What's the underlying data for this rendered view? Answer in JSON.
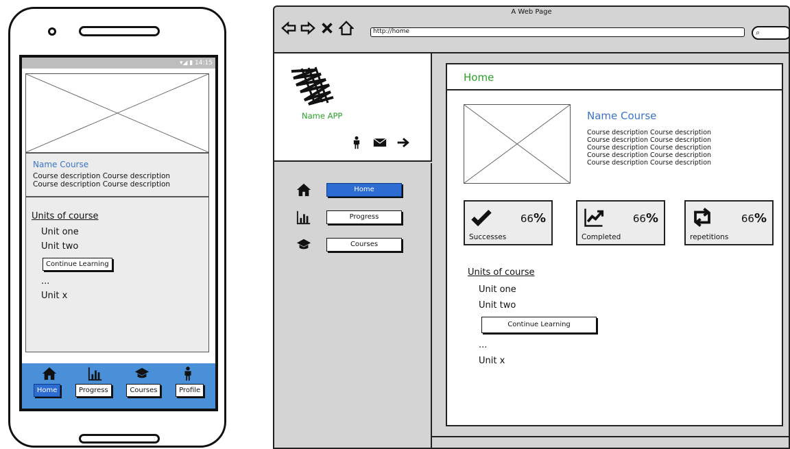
{
  "phone": {
    "status": "▾◢ ▮ 14:15",
    "course": {
      "title": "Name Course",
      "desc_line_1": "Course description  Course description",
      "desc_line_2": "Course description  Course description"
    },
    "units": {
      "title": "Units of course",
      "unit_one": "Unit one",
      "unit_two": "Unit two",
      "continue": "Continue Learning",
      "ellipsis": "...",
      "unit_x": "Unit x"
    },
    "nav": {
      "home": "Home",
      "progress": "Progress",
      "courses": "Courses",
      "profile": "Profile"
    }
  },
  "browser": {
    "title": "A Web Page",
    "url": "http://home",
    "app_name": "Name APP",
    "side_nav": {
      "home": "Home",
      "progress": "Progress",
      "courses": "Courses"
    },
    "content": {
      "title": "Home",
      "course_title": "Name Course",
      "course_desc": [
        "Course description  Course description",
        "Course description  Course description",
        "Course description  Course description",
        "Course description  Course description",
        "Course description  Course description"
      ],
      "stats": [
        {
          "label": "Successes",
          "value": "66",
          "unit": "%"
        },
        {
          "label": "Completed",
          "value": "66",
          "unit": "%"
        },
        {
          "label": "repetitions",
          "value": "66",
          "unit": "%"
        }
      ],
      "units": {
        "title": "Units of course",
        "unit_one": "Unit one",
        "unit_two": "Unit two",
        "continue": "Continue Learning",
        "ellipsis": "...",
        "unit_x": "Unit x"
      }
    }
  },
  "colors": {
    "accent_blue": "#2d6cd1",
    "nav_blue": "#4a90d9",
    "green_text": "#2aa02a",
    "course_blue": "#3b73c8"
  }
}
